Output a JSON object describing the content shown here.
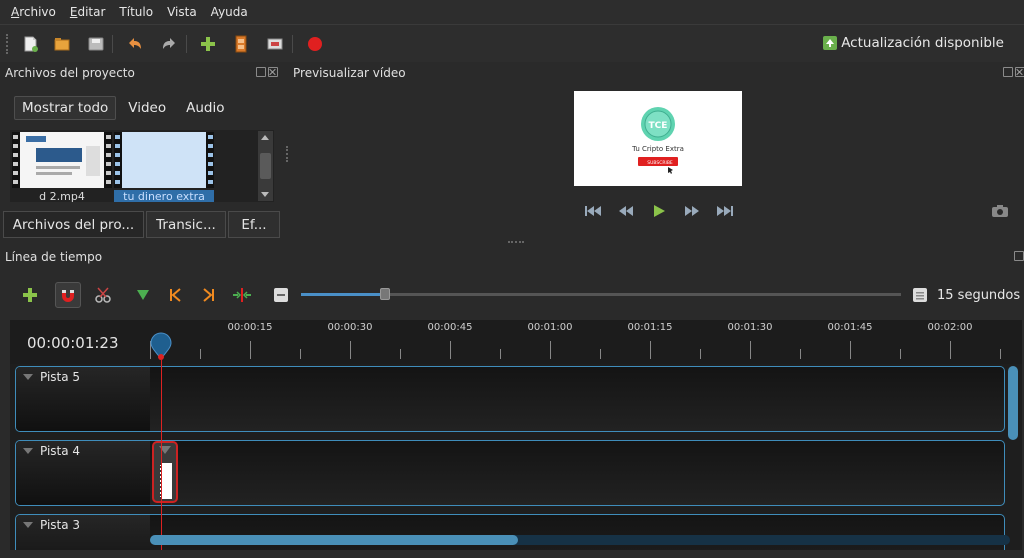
{
  "menu": [
    {
      "mnemonic": "A",
      "rest": "rchivo"
    },
    {
      "mnemonic": "E",
      "rest": "ditar"
    },
    {
      "mnemonic": "",
      "rest": "Título"
    },
    {
      "mnemonic": "",
      "rest": "Vista"
    },
    {
      "mnemonic": "",
      "rest": "Ayuda"
    }
  ],
  "toolbar": {
    "update_label": "Actualización disponible",
    "icons": [
      "new-project-icon",
      "open-project-icon",
      "save-project-icon",
      "undo-icon",
      "redo-icon",
      "import-files-icon",
      "choose-profile-icon",
      "fullscreen-icon",
      "export-video-icon"
    ]
  },
  "project_files": {
    "title": "Archivos del proyecto",
    "filters": [
      "Mostrar todo",
      "Video",
      "Audio"
    ],
    "files": [
      {
        "label": "d 2.mp4"
      },
      {
        "label": "tu dinero extra"
      }
    ],
    "tabs": [
      "Archivos del pro...",
      "Transic...",
      "Ef..."
    ]
  },
  "preview": {
    "title": "Previsualizar vídeo",
    "frame_text": "Tu Cripto Extra",
    "logo_text": "TCE",
    "subscribe_label": "SUBSCRIBE"
  },
  "timeline": {
    "title": "Línea de tiempo",
    "timecode": "00:00:01:23",
    "zoom_label": "15 segundos",
    "zoom_fraction": 0.14,
    "ruler_labels": [
      "00:00:15",
      "00:00:30",
      "00:00:45",
      "00:01:00",
      "00:01:15",
      "00:01:30",
      "00:01:45",
      "00:02:00"
    ],
    "tracks": [
      {
        "name": "Pista 5"
      },
      {
        "name": "Pista 4"
      },
      {
        "name": "Pista 3"
      }
    ]
  },
  "colors": {
    "accent": "#4a90c8",
    "playhead": "#dd2222",
    "track_border": "#3f8dbb"
  }
}
